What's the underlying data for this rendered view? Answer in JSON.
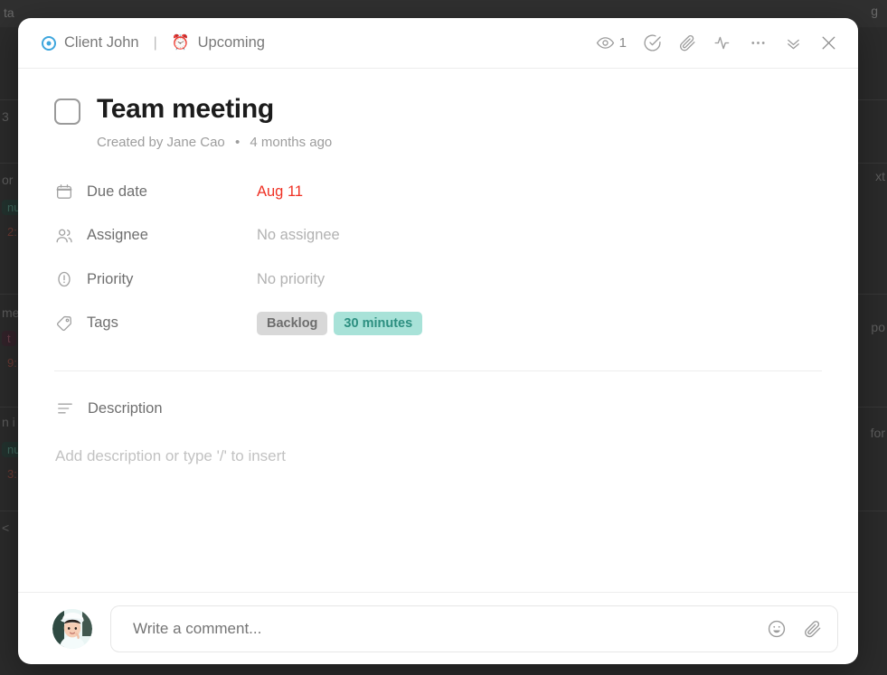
{
  "backdrop": {
    "topbar_left": "ta",
    "topbar_right": "g",
    "rows": [
      {
        "left": "3",
        "right": ""
      },
      {
        "left": "or",
        "chip": "nu",
        "time": "2:",
        "right": "xt"
      },
      {
        "left": "me",
        "chip": "t",
        "time": "9:",
        "right": "po"
      },
      {
        "left": "n i",
        "chip": "nu",
        "time": "3:",
        "right": "for"
      },
      {
        "left": "<",
        "right": ""
      }
    ]
  },
  "header": {
    "breadcrumb": [
      {
        "icon": "target-icon",
        "label": "Client John"
      },
      {
        "icon": "alarm-clock-icon",
        "label": "Upcoming"
      }
    ],
    "separator": "|",
    "watch_count": "1",
    "actions": [
      {
        "name": "watchers",
        "icon": "eye-icon"
      },
      {
        "name": "complete",
        "icon": "check-circle-icon"
      },
      {
        "name": "attach",
        "icon": "paperclip-icon"
      },
      {
        "name": "activity",
        "icon": "activity-pulse-icon"
      },
      {
        "name": "more",
        "icon": "ellipsis-icon"
      },
      {
        "name": "collapse",
        "icon": "chevron-double-down-icon"
      },
      {
        "name": "close",
        "icon": "close-icon"
      }
    ]
  },
  "task": {
    "title": "Team meeting",
    "created_by_prefix": "Created by",
    "created_by": "Jane Cao",
    "meta_dot": "•",
    "created_ago": "4 months ago",
    "properties": [
      {
        "icon": "calendar-icon",
        "label": "Due date",
        "value": "Aug 11",
        "value_color": "#ef3124",
        "type": "date"
      },
      {
        "icon": "people-icon",
        "label": "Assignee",
        "value": "No assignee",
        "type": "text"
      },
      {
        "icon": "priority-icon",
        "label": "Priority",
        "value": "No priority",
        "type": "text"
      },
      {
        "icon": "tag-icon",
        "label": "Tags",
        "type": "tags"
      }
    ],
    "tags": [
      {
        "label": "Backlog",
        "style": "gray",
        "bg": "#d8d8d8",
        "fg": "#6d6d6d"
      },
      {
        "label": "30 minutes",
        "style": "teal",
        "bg": "#a8e2d8",
        "fg": "#2c8f80"
      }
    ],
    "description": {
      "icon": "description-lines-icon",
      "title": "Description",
      "placeholder": "Add description or type '/' to insert"
    }
  },
  "footer": {
    "avatar": "user-avatar",
    "comment_placeholder": "Write a comment...",
    "actions": [
      {
        "name": "emoji",
        "icon": "emoji-smile-icon"
      },
      {
        "name": "attach",
        "icon": "paperclip-icon"
      }
    ]
  }
}
